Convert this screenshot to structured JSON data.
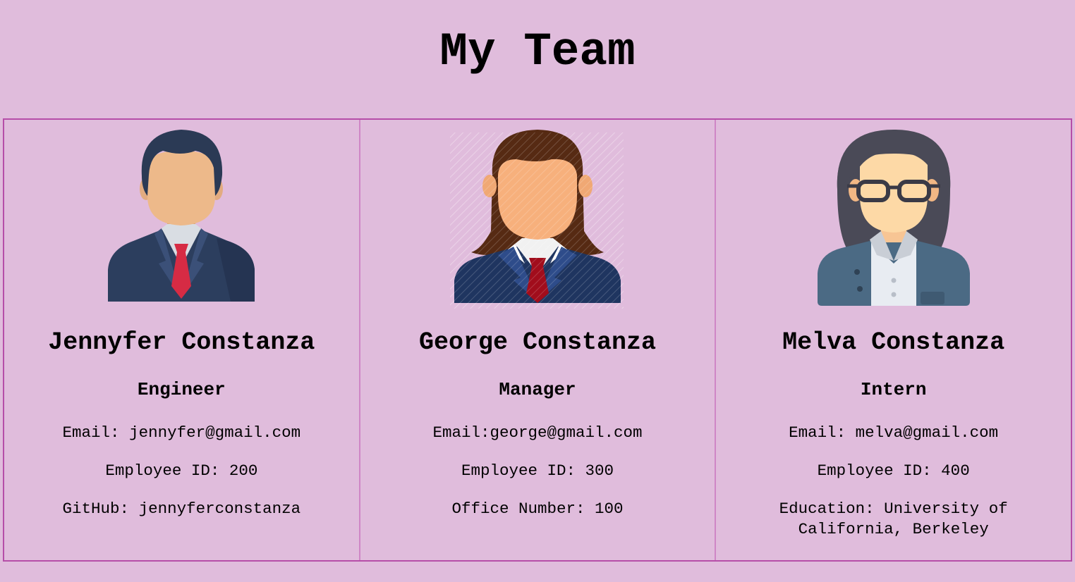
{
  "title": "My Team",
  "employees": [
    {
      "name": "Jennyfer Constanza",
      "role": "Engineer",
      "email": "Email: jennyfer@gmail.com",
      "id": "Employee ID: 200",
      "extra": "GitHub: jennyferconstanza",
      "avatar_icon": "male-engineer-avatar-icon"
    },
    {
      "name": "George Constanza",
      "role": "Manager",
      "email": "Email:george@gmail.com",
      "id": "Employee ID: 300",
      "extra": "Office Number: 100",
      "avatar_icon": "female-manager-avatar-icon"
    },
    {
      "name": "Melva Constanza",
      "role": "Intern",
      "email": "Email: melva@gmail.com",
      "id": "Employee ID: 400",
      "extra": "Education: University of California, Berkeley",
      "avatar_icon": "female-intern-avatar-icon"
    }
  ],
  "colors": {
    "background": "#e0bcdc",
    "border": "#b64ea8",
    "divider": "#cf86c6"
  }
}
